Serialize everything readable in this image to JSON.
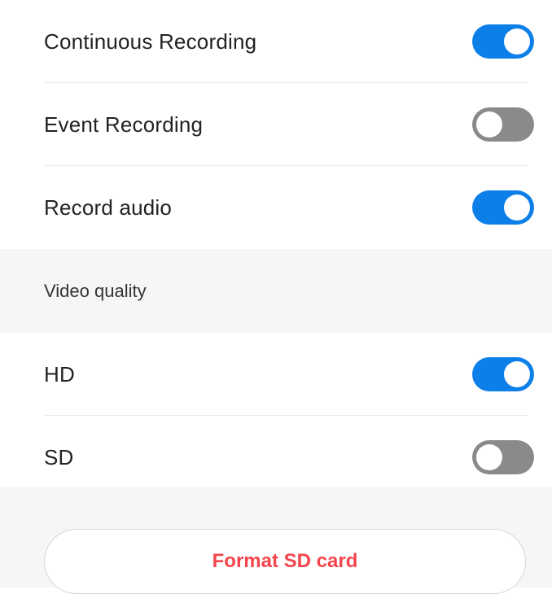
{
  "settings": {
    "recording": [
      {
        "label": "Continuous Recording",
        "enabled": true
      },
      {
        "label": "Event Recording",
        "enabled": false
      },
      {
        "label": "Record audio",
        "enabled": true
      }
    ],
    "video_quality": {
      "title": "Video quality",
      "options": [
        {
          "label": "HD",
          "enabled": true
        },
        {
          "label": "SD",
          "enabled": false
        }
      ]
    },
    "format_button_label": "Format SD card"
  },
  "colors": {
    "toggle_on": "#0d7fe8",
    "toggle_off": "#8a8a8a",
    "destructive": "#f4454d",
    "section_background": "#f6f6f6"
  }
}
